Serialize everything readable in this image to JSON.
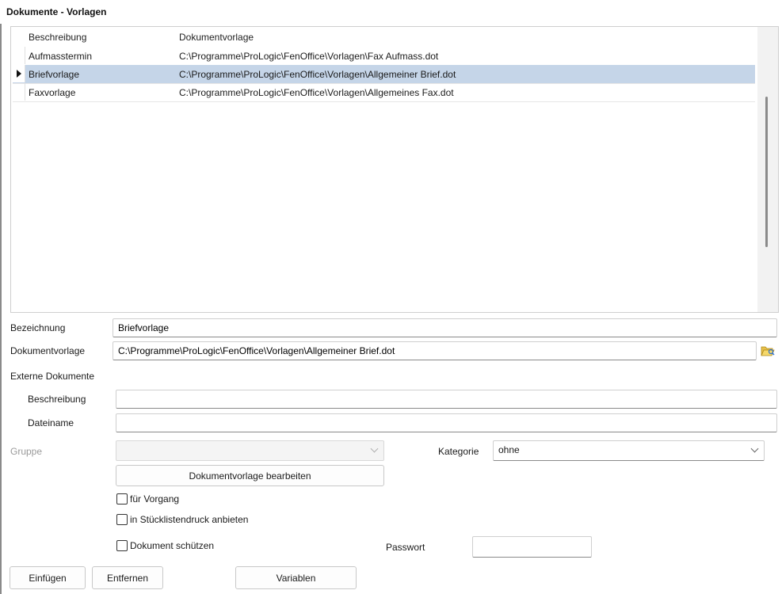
{
  "window": {
    "title": "Dokumente - Vorlagen"
  },
  "grid": {
    "columns": [
      "Beschreibung",
      "Dokumentvorlage"
    ],
    "rows": [
      {
        "beschreibung": "Aufmasstermin",
        "vorlage": "C:\\Programme\\ProLogic\\FenOffice\\Vorlagen\\Fax Aufmass.dot",
        "selected": false
      },
      {
        "beschreibung": "Briefvorlage",
        "vorlage": "C:\\Programme\\ProLogic\\FenOffice\\Vorlagen\\Allgemeiner Brief.dot",
        "selected": true
      },
      {
        "beschreibung": "Faxvorlage",
        "vorlage": "C:\\Programme\\ProLogic\\FenOffice\\Vorlagen\\Allgemeines Fax.dot",
        "selected": false
      }
    ]
  },
  "form": {
    "bezeichnung_label": "Bezeichnung",
    "bezeichnung_value": "Briefvorlage",
    "dokumentvorlage_label": "Dokumentvorlage",
    "dokumentvorlage_value": "C:\\Programme\\ProLogic\\FenOffice\\Vorlagen\\Allgemeiner Brief.dot",
    "browse_icon": "folder-open-icon",
    "externe_label": "Externe Dokumente",
    "ext_beschreibung_label": "Beschreibung",
    "ext_beschreibung_value": "",
    "dateiname_label": "Dateiname",
    "dateiname_value": "",
    "gruppe_label": "Gruppe",
    "gruppe_value": "",
    "kategorie_label": "Kategorie",
    "kategorie_value": "ohne",
    "bearbeiten_label": "Dokumentvorlage bearbeiten",
    "fuer_vorgang_label": "für Vorgang",
    "stueckliste_label": "in Stücklistendruck anbieten",
    "schuetzen_label": "Dokument schützen",
    "passwort_label": "Passwort",
    "passwort_value": ""
  },
  "buttons": {
    "einfuegen": "Einfügen",
    "entfernen": "Entfernen",
    "variablen": "Variablen"
  },
  "colors": {
    "selection": "#c5d5e8",
    "border": "#cfcfcf"
  }
}
